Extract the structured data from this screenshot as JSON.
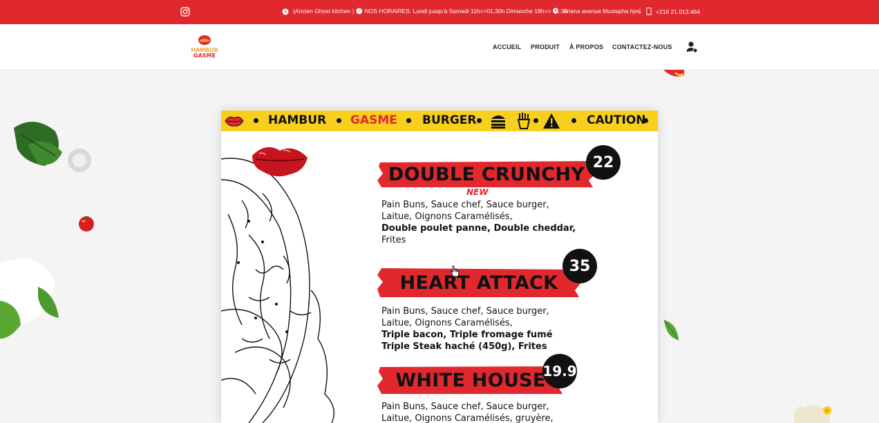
{
  "topbar": {
    "hours_text": "(Ancien Ghost kitchen ) 🕑 NOS HORAIRES: Lundi jusqu'à Samedi 11h=>01:30h Dimanche 18h=> 01:30",
    "address": "Ariana avenue Mustapha hjeij.",
    "phone": "+216 21.013.464"
  },
  "header": {
    "logo_line1": "HAMBUR",
    "logo_line2": "GASME",
    "nav": [
      "ACCUEIL",
      "PRODUIT",
      "À PROPOS",
      "CONTACTEZ-NOUS"
    ]
  },
  "menu_card": {
    "strip": [
      "HAMBUR",
      "GASME",
      "BURGER",
      "CAUTION"
    ],
    "items": [
      {
        "name": "DOUBLE CRUNCHY",
        "price": "22",
        "badge": "NEW",
        "lines": [
          "Pain Buns, Sauce chef, Sauce burger,",
          "Laitue, Oignons Caramélisés,",
          "Double poulet panne, Double cheddar,",
          "Frites"
        ]
      },
      {
        "name": "HEART ATTACK",
        "price": "35",
        "lines": [
          "Pain Buns, Sauce chef, Sauce burger,",
          "Laitue, Oignons Caramélisés,",
          "Triple bacon, Triple fromage fumé",
          "Triple Steak haché (450g), Frites"
        ]
      },
      {
        "name": "WHITE HOUSE",
        "price": "19.9",
        "lines": [
          "Pain Buns, Sauce chef, Sauce burger,",
          "Laitue, Oignons Caramélisés, gruyère,"
        ]
      }
    ]
  },
  "colors": {
    "brand_red": "#e1282e",
    "strip_yellow": "#f7cf1c",
    "dark": "#111111"
  }
}
